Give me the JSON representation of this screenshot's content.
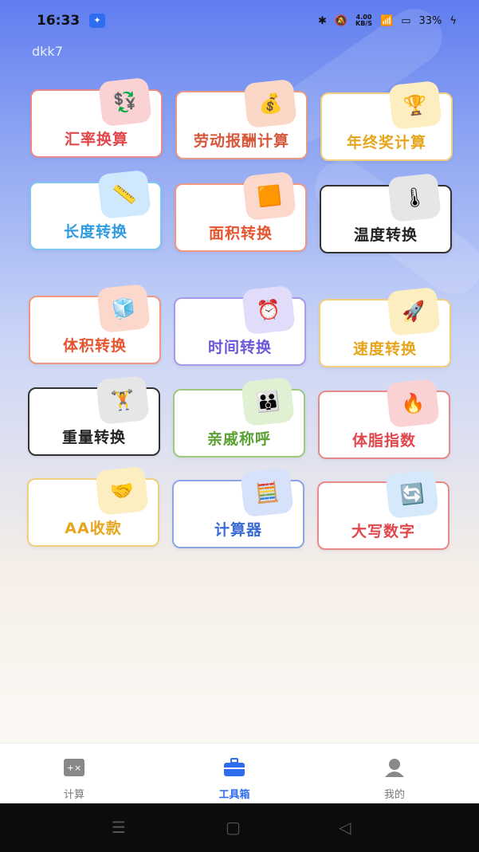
{
  "status_bar": {
    "time": "16:33",
    "net_speed_value": "4.00",
    "net_speed_unit": "KB/S",
    "battery": "33%"
  },
  "header": {
    "username": "dkk7"
  },
  "tools": [
    {
      "label": "汇率换算",
      "color": "#e0474c",
      "border": "#e88a8c",
      "icon": "coins-icon",
      "icon_bg": "#fbd2d4",
      "glyph": "💱"
    },
    {
      "label": "劳动报酬计算",
      "color": "#d8573a",
      "border": "#e79a86",
      "icon": "money-bag-icon",
      "icon_bg": "#fbd7c8",
      "glyph": "💰"
    },
    {
      "label": "年终奖计算",
      "color": "#e6a51d",
      "border": "#f0cf7e",
      "icon": "trophy-icon",
      "icon_bg": "#fdeec2",
      "glyph": "🏆"
    },
    {
      "label": "长度转换",
      "color": "#2f9be0",
      "border": "#7fc6f0",
      "icon": "ruler-icon",
      "icon_bg": "#cfe8fb",
      "glyph": "📏"
    },
    {
      "label": "面积转换",
      "color": "#e5552f",
      "border": "#f0977f",
      "icon": "square-icon",
      "icon_bg": "#fcd7cb",
      "glyph": "🟧"
    },
    {
      "label": "温度转换",
      "color": "#222222",
      "border": "#333333",
      "icon": "thermometer-icon",
      "icon_bg": "#e6e6e6",
      "glyph": "🌡"
    },
    {
      "label": "体积转换",
      "color": "#e5552f",
      "border": "#f0977f",
      "icon": "cube-icon",
      "icon_bg": "#fcd7cb",
      "glyph": "🧊"
    },
    {
      "label": "时间转换",
      "color": "#6a58d8",
      "border": "#a49bea",
      "icon": "clock-icon",
      "icon_bg": "#e0dcfa",
      "glyph": "⏰"
    },
    {
      "label": "速度转换",
      "color": "#e6a51d",
      "border": "#f0cf7e",
      "icon": "rocket-icon",
      "icon_bg": "#fdeec2",
      "glyph": "🚀"
    },
    {
      "label": "重量转换",
      "color": "#222222",
      "border": "#333333",
      "icon": "kettlebell-icon",
      "icon_bg": "#e6e6e6",
      "glyph": "🏋"
    },
    {
      "label": "亲戚称呼",
      "color": "#5aa033",
      "border": "#9ccb7e",
      "icon": "family-icon",
      "icon_bg": "#e0f0d2",
      "glyph": "👪"
    },
    {
      "label": "体脂指数",
      "color": "#e0474c",
      "border": "#e88a8c",
      "icon": "flame-kcal-icon",
      "icon_bg": "#fbd2d4",
      "glyph": "🔥"
    },
    {
      "label": "AA收款",
      "color": "#e6a51d",
      "border": "#f0cf7e",
      "icon": "hand-coin-icon",
      "icon_bg": "#fdeec2",
      "glyph": "🤝"
    },
    {
      "label": "计算器",
      "color": "#3b6bd6",
      "border": "#8aa5e6",
      "icon": "calculator-icon",
      "icon_bg": "#d6e1fa",
      "glyph": "🧮"
    },
    {
      "label": "大写数字",
      "color": "#e0474c",
      "border": "#e88a8c",
      "icon": "arrows-exchange-icon",
      "icon_bg": "#d6e9fb",
      "glyph": "🔄"
    }
  ],
  "bottom_nav": {
    "items": [
      {
        "label": "计算"
      },
      {
        "label": "工具箱"
      },
      {
        "label": "我的"
      }
    ],
    "active_color": "#2f6df0",
    "inactive_color": "#777777"
  }
}
